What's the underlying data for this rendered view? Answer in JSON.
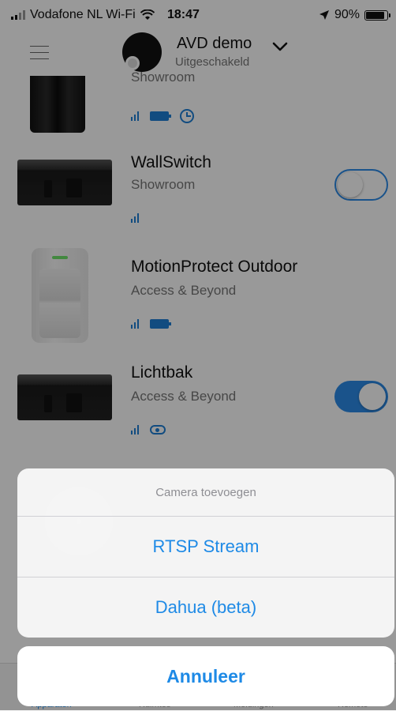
{
  "status_bar": {
    "carrier": "Vodafone NL Wi-Fi",
    "time": "18:47",
    "battery": "90%",
    "battery_level": 0.9
  },
  "header": {
    "hub_name": "AVD demo",
    "hub_status": "Uitgeschakeld"
  },
  "devices": [
    {
      "name": "",
      "room": "Showroom",
      "control": "none"
    },
    {
      "name": "WallSwitch",
      "room": "Showroom",
      "control": "toggle",
      "on": false
    },
    {
      "name": "MotionProtect Outdoor",
      "room": "Access & Beyond",
      "control": "none"
    },
    {
      "name": "Lichtbak",
      "room": "Access & Beyond",
      "control": "toggle",
      "on": true
    }
  ],
  "action_sheet": {
    "title": "Camera toevoegen",
    "options": [
      "RTSP Stream",
      "Dahua (beta)"
    ],
    "cancel_label": "Annuleer"
  },
  "tab_bar": {
    "tabs": [
      "Apparaten",
      "Ruimtes",
      "Meldingen",
      "Remote"
    ]
  },
  "colors": {
    "accent": "#1e8ae6",
    "toggle": "#2c8be8",
    "overlay": "rgba(0,0,0,0.40)"
  }
}
